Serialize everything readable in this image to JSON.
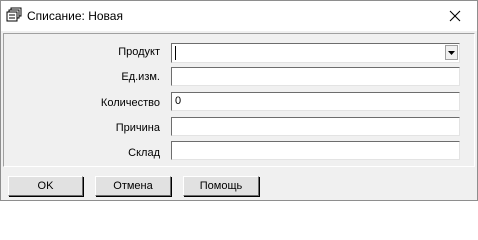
{
  "window": {
    "title": "Списание: Новая",
    "icons": {
      "app": "stack-of-cards-icon",
      "close": "close-icon"
    }
  },
  "form": {
    "product_label": "Продукт",
    "product_value": "",
    "unit_label": "Ед.изм.",
    "unit_value": "",
    "quantity_label": "Количество",
    "quantity_value": "0",
    "reason_label": "Причина",
    "reason_value": "",
    "warehouse_label": "Склад",
    "warehouse_value": ""
  },
  "buttons": {
    "ok": "OK",
    "cancel": "Отмена",
    "help": "Помощь"
  }
}
